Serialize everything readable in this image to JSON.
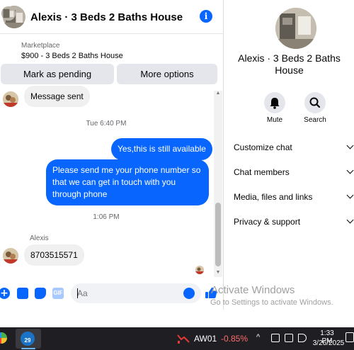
{
  "header": {
    "title": "Alexis · 3 Beds 2 Baths House",
    "info_icon": "i"
  },
  "marketplace": {
    "label": "Marketplace",
    "listing": "$900 - 3 Beds 2 Baths House"
  },
  "actions": {
    "mark_pending": "Mark as pending",
    "more_options": "More options"
  },
  "messages": {
    "incoming_1": "Message sent",
    "timestamp_1": "Tue 6:40 PM",
    "outgoing_1": "Yes,this is still available",
    "outgoing_2": "Please send me your phone  number so that we can get in touch with you through phone",
    "timestamp_2": "1:06 PM",
    "sender": "Alexis",
    "incoming_2": "8703515571"
  },
  "composer": {
    "placeholder": "Aa",
    "plus_icon": "+",
    "gif_label": "GIF"
  },
  "details": {
    "title": "Alexis · 3 Beds 2 Baths House",
    "mute_label": "Mute",
    "search_label": "Search",
    "menu": [
      {
        "label": "Customize chat"
      },
      {
        "label": "Chat members"
      },
      {
        "label": "Media, files and links"
      },
      {
        "label": "Privacy & support"
      }
    ]
  },
  "watermark": {
    "line1": "Activate Windows",
    "line2": "Go to Settings to activate Windows."
  },
  "taskbar": {
    "app_badge": "29",
    "stock_name": "AW01",
    "stock_change": "-0.85%",
    "tray_chevron": "^",
    "time": "1:33 PM",
    "date": "3/26/2025"
  },
  "colors": {
    "accent": "#0866ff",
    "bubble_in": "#f0f0f0",
    "taskbar": "#1f1f23",
    "stock_down": "#ff6b6b"
  }
}
